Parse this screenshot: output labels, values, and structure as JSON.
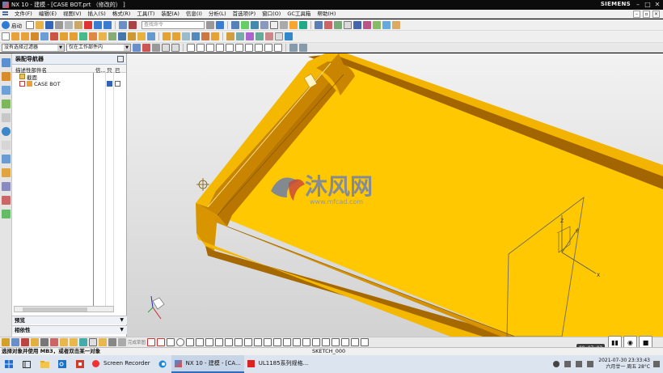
{
  "window": {
    "title": "NX 10 - 建模 - [CASE BOT.prt （修改的）  ]",
    "brand": "SIEMENS"
  },
  "menu": {
    "items": [
      "文件(F)",
      "编辑(E)",
      "视图(V)",
      "插入(S)",
      "格式(R)",
      "工具(T)",
      "装配(A)",
      "信息(I)",
      "分析(L)",
      "首选项(P)",
      "窗口(O)",
      "GC工具箱",
      "帮助(H)"
    ]
  },
  "toolbar": {
    "start_label": "启动",
    "search_placeholder": "查找命令"
  },
  "selection": {
    "filter_value": "没有选择过滤器",
    "scope_value": "仅在工作部件内"
  },
  "navigator": {
    "title": "装配导航器",
    "columns": [
      "描述性部件名",
      "信...",
      "只",
      "已"
    ],
    "rows": [
      {
        "label": "截面",
        "level": 1
      },
      {
        "label": "CASE BOT",
        "level": 1
      }
    ],
    "sections": [
      "预览",
      "相依性"
    ]
  },
  "viewport": {
    "watermark_text": "沐风网",
    "watermark_url": "www.mfcad.com",
    "axis_x": "X",
    "axis_y": "Y",
    "axis_z": "Z",
    "body_color": "#f5b800",
    "body_dark": "#b87a00",
    "floor_color": "#ffc800"
  },
  "bottom_toolbar": {
    "label": "完成草图"
  },
  "status": {
    "message": "选择对象并使用 MB3，或者双击某一对象",
    "sketch_name": "SKETCH_000"
  },
  "recorder": {
    "elapsed": "00:07:02"
  },
  "taskbar": {
    "tasks": [
      {
        "label": "Screen Recorder",
        "active": false
      },
      {
        "label": "NX 10 - 建模 - [CA...",
        "active": true
      },
      {
        "label": "UL1185系列规格...",
        "active": false
      }
    ],
    "date_time": "2021-07-30 23:33:43",
    "weekday_weather": "六月廿一 周五 28°C"
  }
}
